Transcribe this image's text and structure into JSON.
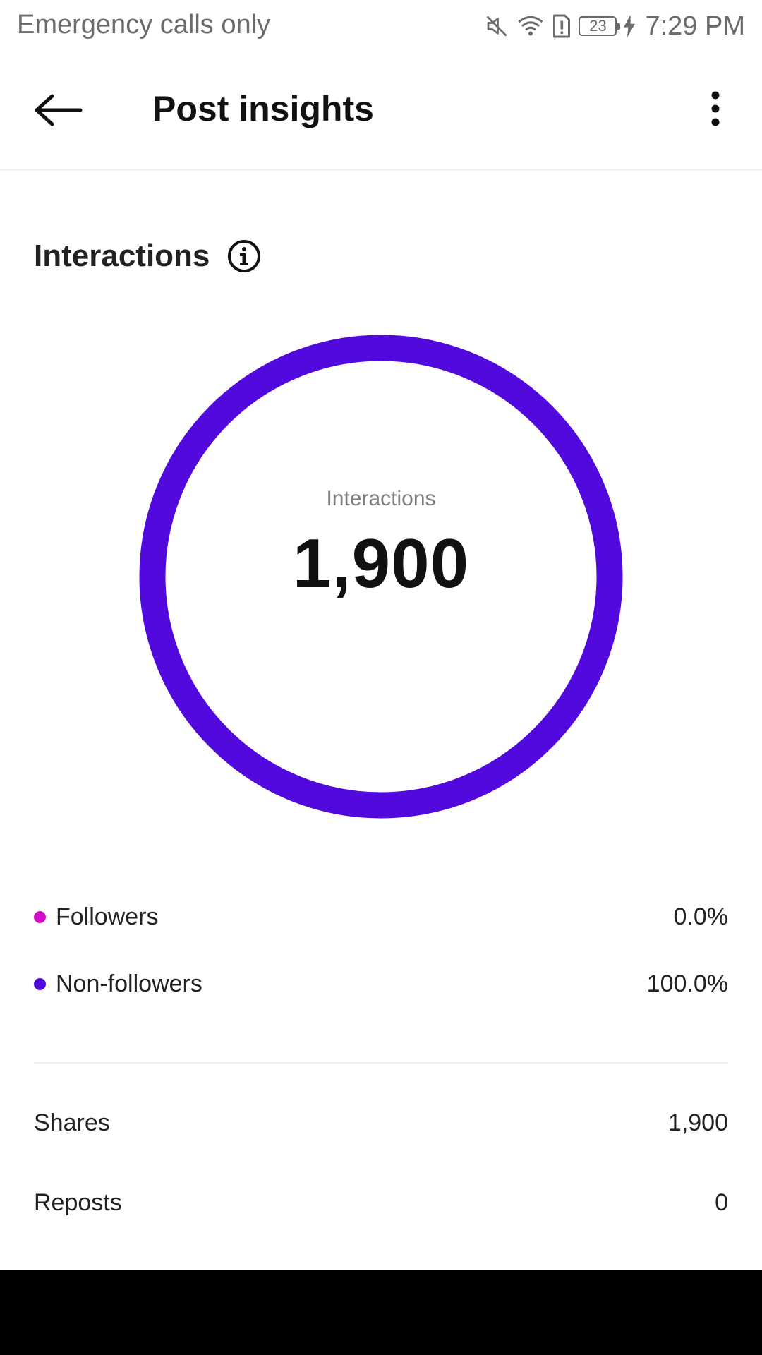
{
  "status_bar": {
    "carrier": "Emergency calls only",
    "battery_level": "23",
    "time": "7:29 PM",
    "icons": [
      "mute-icon",
      "wifi-icon",
      "sim-alert-icon",
      "battery-icon",
      "charging-icon"
    ]
  },
  "header": {
    "title": "Post insights",
    "back_icon": "arrow-left-icon",
    "menu_icon": "more-vertical-icon"
  },
  "section": {
    "title": "Interactions",
    "info_icon": "info-icon"
  },
  "donut": {
    "label": "Interactions",
    "value": "1,900",
    "followers_fraction": 0.0,
    "non_followers_fraction": 1.0
  },
  "legend": [
    {
      "label": "Followers",
      "value": "0.0%",
      "color": "#D20FC8"
    },
    {
      "label": "Non-followers",
      "value": "100.0%",
      "color": "#5209DD"
    }
  ],
  "metrics": [
    {
      "label": "Shares",
      "value": "1,900"
    },
    {
      "label": "Reposts",
      "value": "0"
    }
  ],
  "colors": {
    "accent": "#5209DD",
    "followers": "#D20FC8"
  }
}
